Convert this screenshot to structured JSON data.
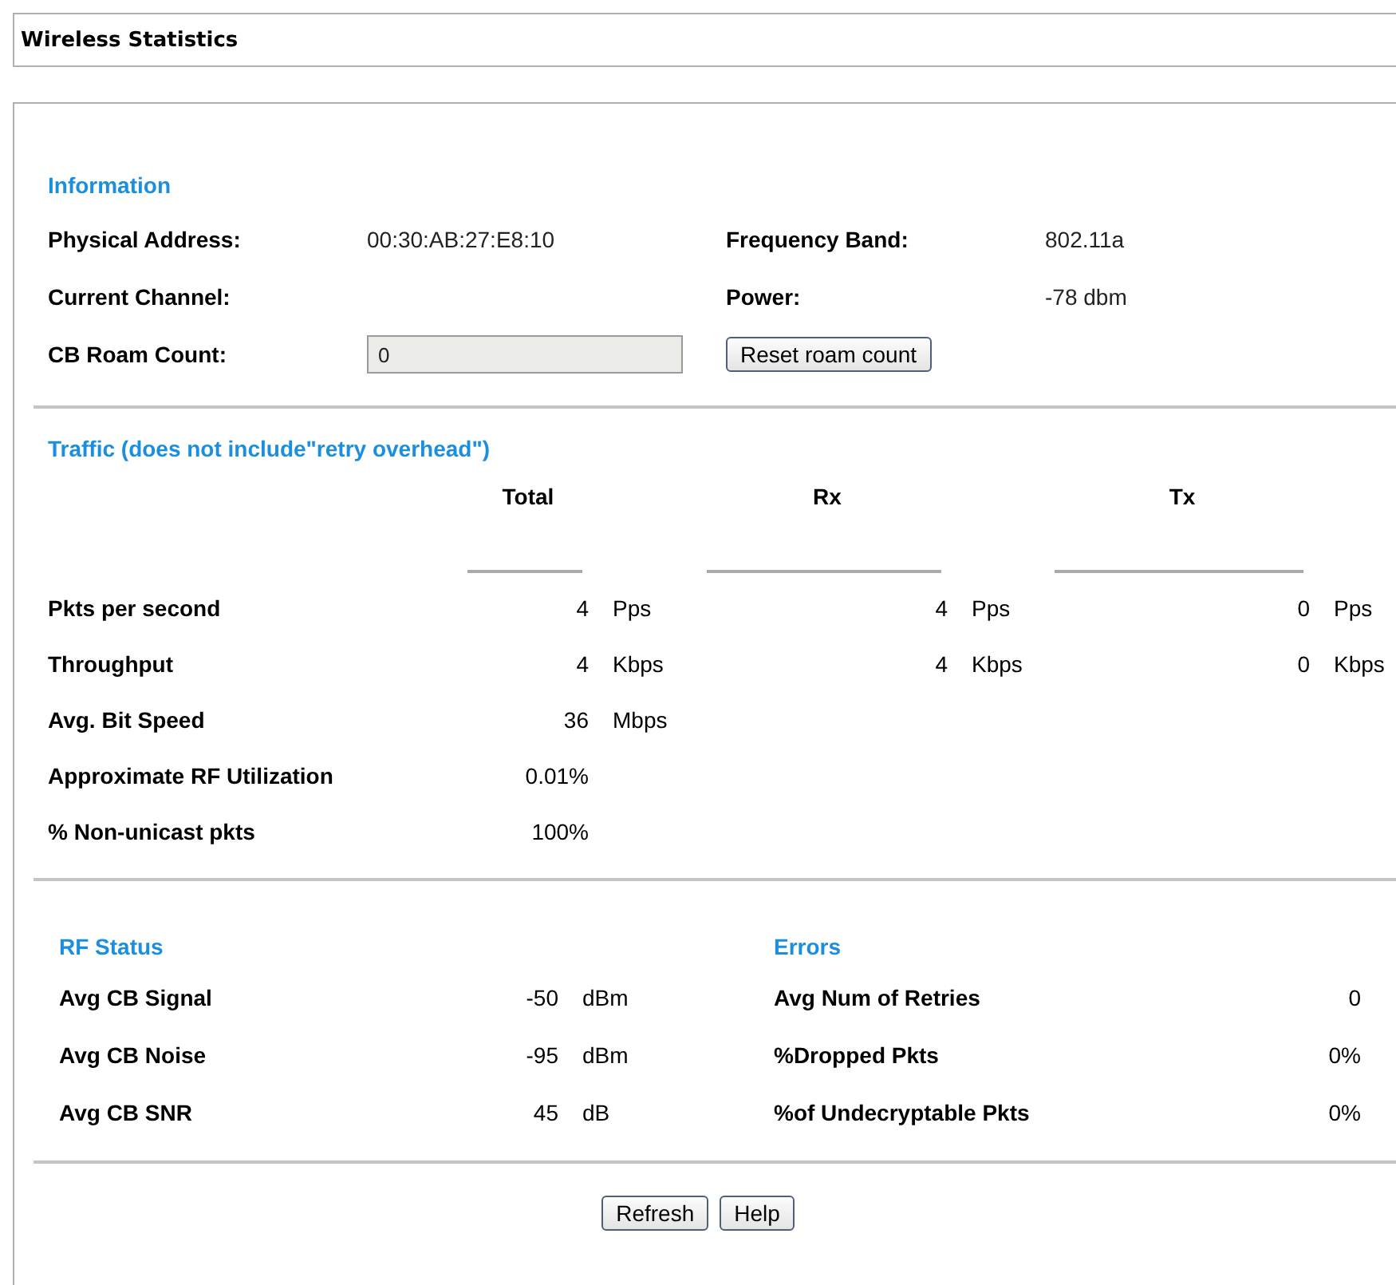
{
  "window": {
    "title": "Wireless Statistics"
  },
  "information": {
    "title": "Information",
    "left": [
      {
        "kind": "text",
        "label": "Physical Address:",
        "value": "00:30:AB:27:E8:10"
      },
      {
        "kind": "text",
        "label": "Current Channel:"
      },
      {
        "kind": "field",
        "label": "CB Roam Count:",
        "value": "0"
      }
    ],
    "right": [
      {
        "kind": "text",
        "label": "Frequency Band:",
        "value": "802.11a"
      },
      {
        "kind": "text",
        "label": "Power:",
        "value": "-78 dbm"
      },
      {
        "kind": "button",
        "label": "Reset roam count"
      }
    ]
  },
  "traffic": {
    "title": "Traffic (does not include\"retry overhead\")",
    "columns": [
      "Total",
      "Rx",
      "Tx"
    ],
    "rows": [
      {
        "label": "Pkts per second",
        "cells": [
          {
            "value": "4",
            "unit": "Pps"
          },
          {
            "value": "4",
            "unit": "Pps"
          },
          {
            "value": "0",
            "unit": "Pps"
          }
        ]
      },
      {
        "label": "Throughput",
        "cells": [
          {
            "value": "4",
            "unit": "Kbps"
          },
          {
            "value": "4",
            "unit": "Kbps"
          },
          {
            "value": "0",
            "unit": "Kbps"
          }
        ]
      },
      {
        "label": "Avg. Bit Speed",
        "cells": [
          {
            "value": "36",
            "unit": "Mbps"
          }
        ]
      },
      {
        "label": "Approximate RF Utilization",
        "cells": [
          {
            "value": "0.01%"
          }
        ]
      },
      {
        "label": "% Non-unicast pkts",
        "cells": [
          {
            "value": "100%"
          }
        ]
      }
    ]
  },
  "rf_status": {
    "title": "RF Status",
    "rows": [
      {
        "label": "Avg CB Signal",
        "value": "-50",
        "unit": "dBm"
      },
      {
        "label": "Avg CB Noise",
        "value": "-95",
        "unit": "dBm"
      },
      {
        "label": "Avg CB SNR",
        "value": "45",
        "unit": "dB"
      }
    ]
  },
  "errors": {
    "title": "Errors",
    "rows": [
      {
        "label": "Avg Num of Retries",
        "value": "0"
      },
      {
        "label": "%Dropped Pkts",
        "value": "0%"
      },
      {
        "label": "%of Undecryptable Pkts",
        "value": "0%"
      }
    ]
  },
  "buttons": [
    "Refresh",
    "Help"
  ]
}
